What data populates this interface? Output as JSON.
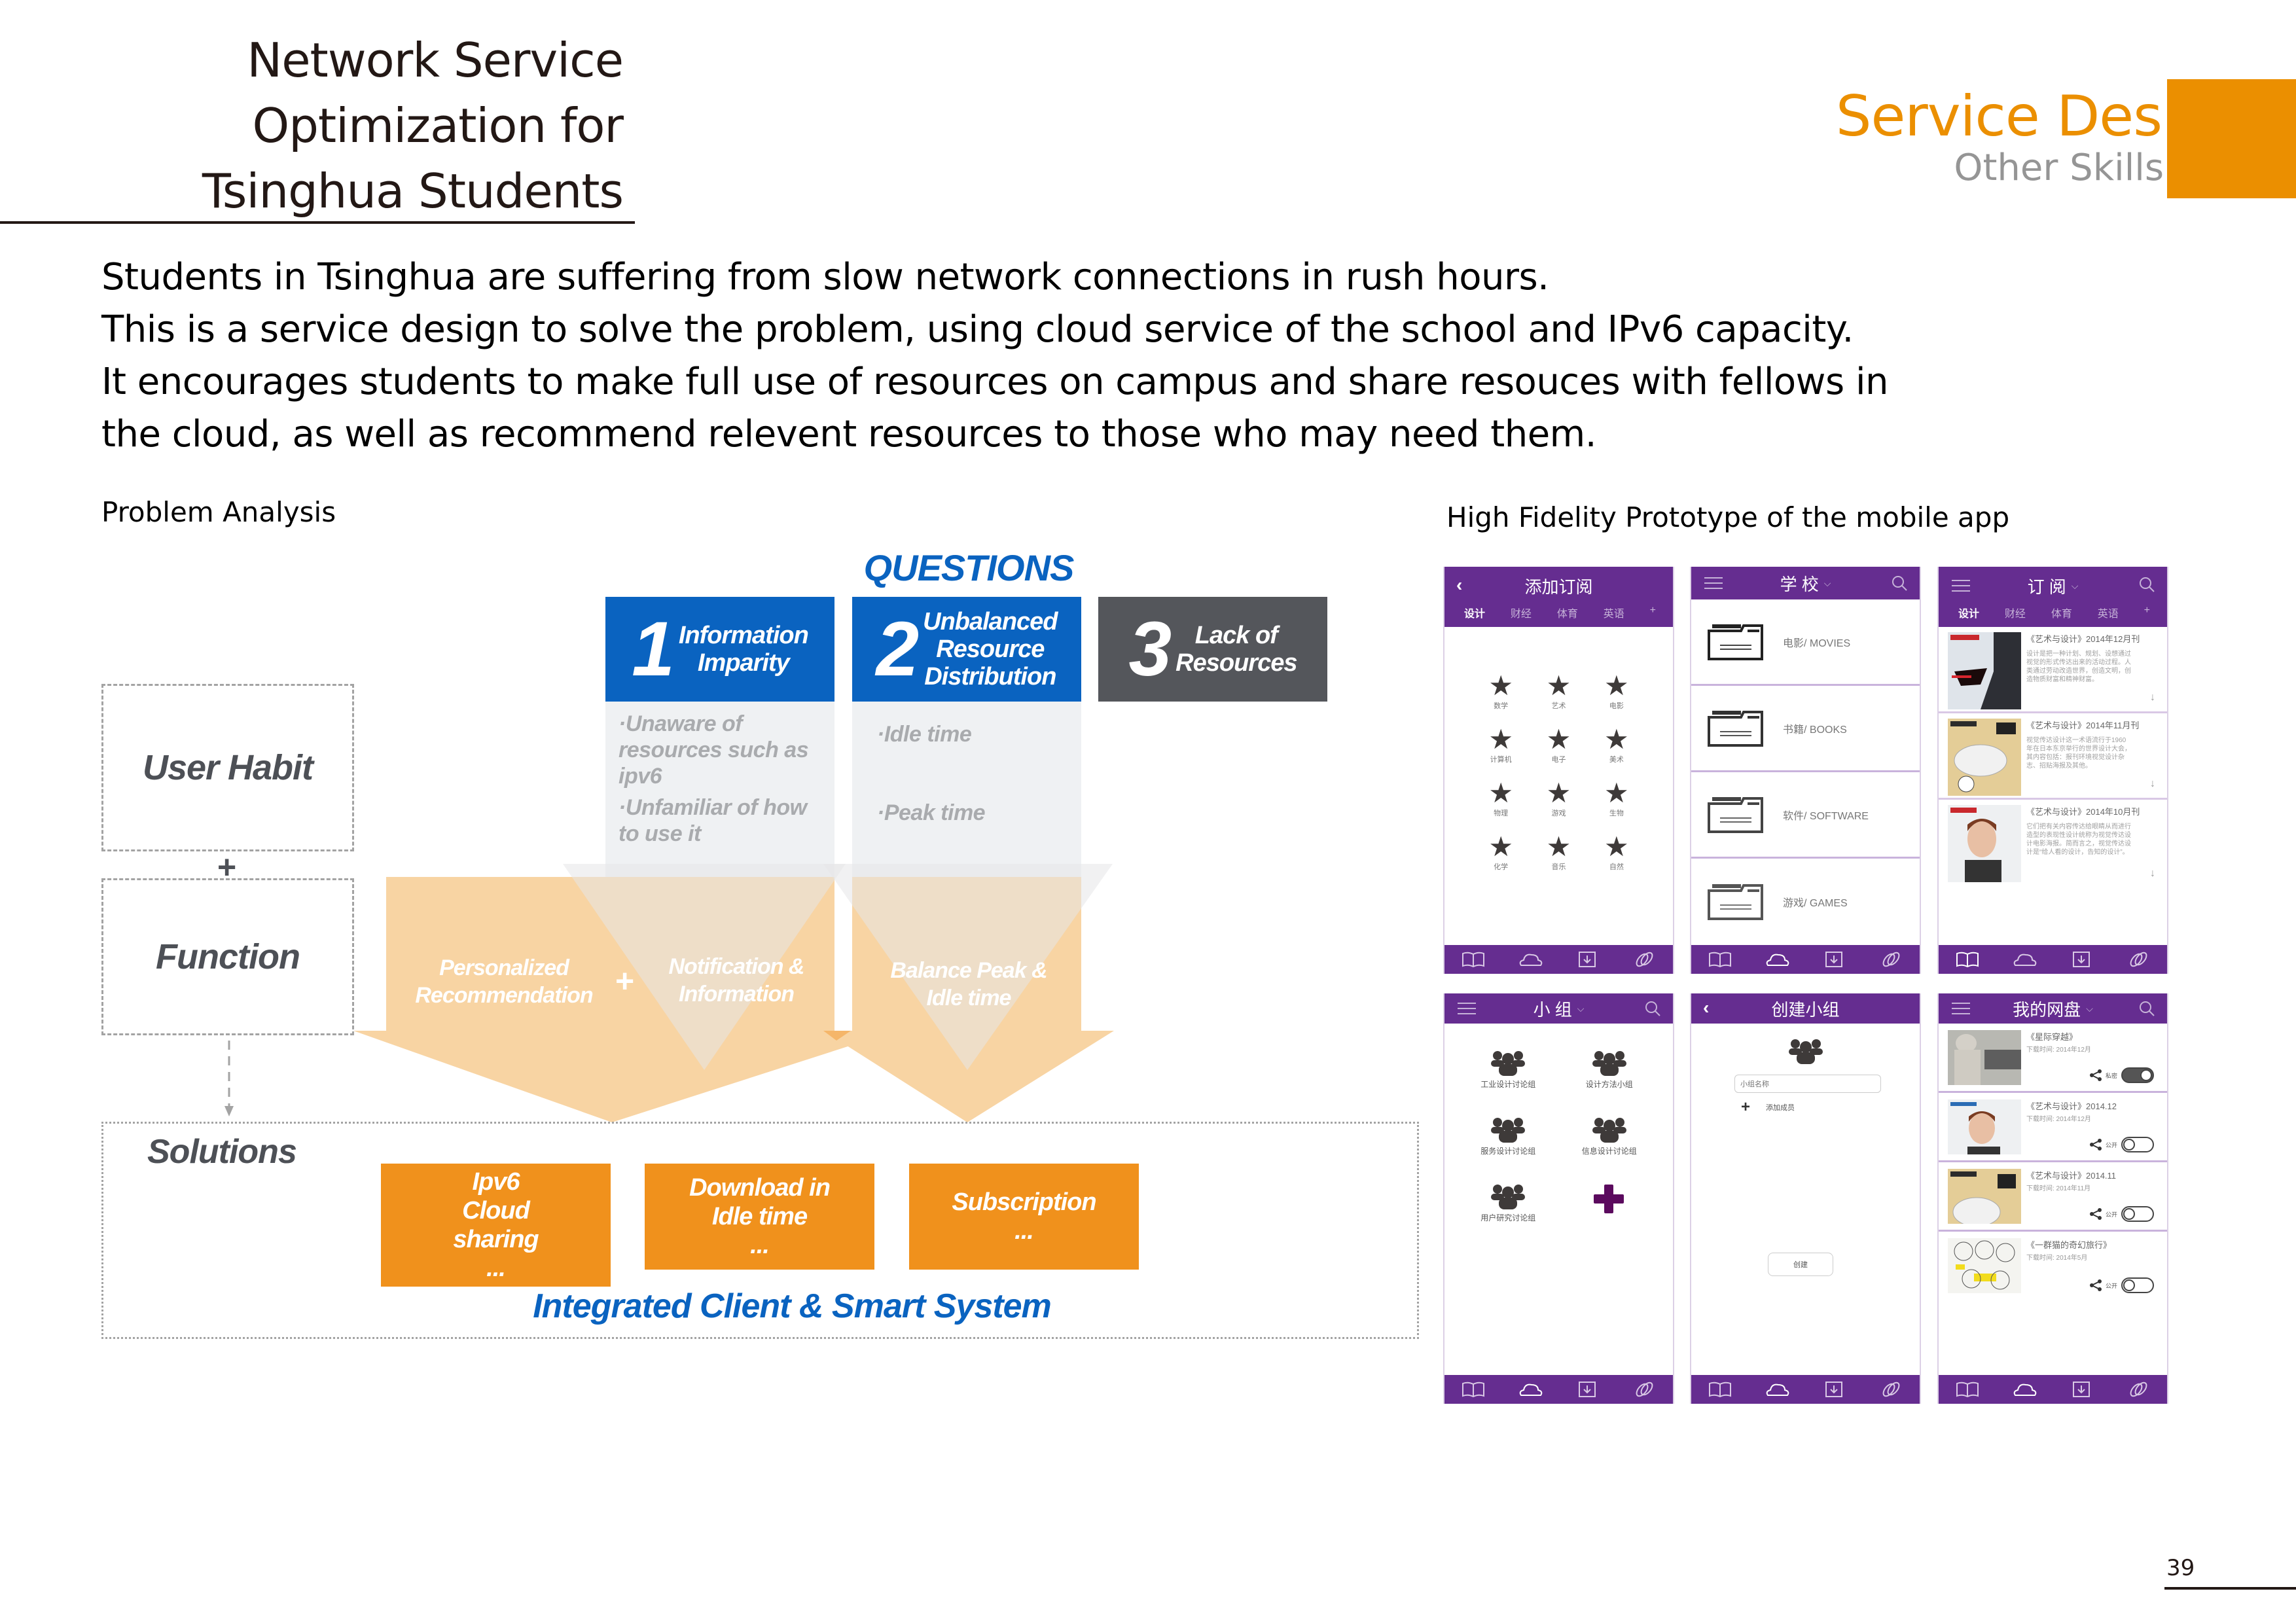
{
  "header": {
    "title_lines": [
      "Network Service",
      "Optimization for",
      "Tsinghua Students"
    ],
    "section_title": "Service Design",
    "section_subtitle": "Other Skills"
  },
  "intro": {
    "lines": [
      "Students in Tsinghua are suffering from slow network connections in rush hours.",
      "This is a service design to solve the problem, using cloud service of the school and IPv6 capacity.",
      "It encourages students to make full use of resources on campus and share resouces with fellows in",
      "the cloud, as well as recommend relevent resources to those who may need them."
    ]
  },
  "labels": {
    "problem_analysis": "Problem Analysis",
    "prototype": "High Fidelity Prototype of the mobile app"
  },
  "diagram": {
    "questions_heading": "QUESTIONS",
    "questions": [
      {
        "number": "1",
        "title_lines": [
          "Information",
          "Imparity"
        ],
        "color": "#0a63c0",
        "details": [
          "·Unaware of resources such as ipv6",
          "·Unfamiliar of  how to use it"
        ]
      },
      {
        "number": "2",
        "title_lines": [
          "Unbalanced",
          "Resource",
          "Distribution"
        ],
        "color": "#0a63c0",
        "details": [
          "·Idle time",
          "·Peak time"
        ]
      },
      {
        "number": "3",
        "title_lines": [
          "Lack of",
          "Resources"
        ],
        "color": "#54565b",
        "details": []
      }
    ],
    "user_habit": "User Habit",
    "plus": "+",
    "function": "Function",
    "functions": {
      "personalized_lines": [
        "Personalized",
        "Recommendation"
      ],
      "notification_lines": [
        "Notification &",
        "Information"
      ],
      "balance_lines": [
        "Balance Peak &",
        "Idle time"
      ]
    },
    "solutions_label": "Solutions",
    "solutions": [
      {
        "lines": [
          "Ipv6",
          "Cloud",
          "sharing",
          "..."
        ]
      },
      {
        "lines": [
          "Download in",
          "Idle time",
          "..."
        ]
      },
      {
        "lines": [
          "Subscription",
          "..."
        ]
      }
    ],
    "integrated_label": "Integrated Client & Smart System",
    "colors": {
      "blue": "#0a63c0",
      "gray_box": "#54565b",
      "light_orange": "#f8d4a3",
      "orange": "#f0911c"
    }
  },
  "app": {
    "accent_color": "#652d90",
    "tabs": [
      "设计",
      "财经",
      "体育",
      "英语",
      "+"
    ],
    "footer_icons": [
      "book-icon",
      "cloud-icon",
      "download-icon",
      "link-icon"
    ],
    "screens": {
      "add_subscription": {
        "title": "添加订阅",
        "topics": [
          "数学",
          "艺术",
          "电影",
          "计算机",
          "电子",
          "美术",
          "物理",
          "游戏",
          "生物",
          "化学",
          "音乐",
          "自然"
        ]
      },
      "school": {
        "title": "学 校",
        "folders": [
          "电影/ MOVIES",
          "书籍/ BOOKS",
          "软件/ SOFTWARE",
          "游戏/ GAMES"
        ]
      },
      "subscription": {
        "title": "订 阅",
        "items": [
          {
            "title": "《艺术与设计》2014年12月刊",
            "desc": "设计是把一种计划、规划、设想通过视觉的形式传达出来的活动过程。人类通过劳动改造世界，创造文明，创造物质财富和精神财富。"
          },
          {
            "title": "《艺术与设计》2014年11月刊",
            "desc": "视觉传达设计这一术语流行于1960年在日本东京举行的世界设计大会，其内容包括：报刊环境视觉设计杂志、招贴海报及其他。"
          },
          {
            "title": "《艺术与设计》2014年10月刊",
            "desc": "它们把有关内容传达给眼睛从而进行造型的表现性设计统称为视觉传达设计电影海报。简而言之，视觉传达设计是“给人看的设计，告知的设计”。"
          }
        ]
      },
      "groups": {
        "title": "小 组",
        "groups": [
          "工业设计讨论组",
          "设计方法小组",
          "服务设计讨论组",
          "信息设计讨论组",
          "用户研究讨论组"
        ]
      },
      "create_group": {
        "title": "创建小组",
        "name_placeholder": "小组名称",
        "add_member": "添加成员",
        "create_button": "创建"
      },
      "my_disk": {
        "title": "我的网盘",
        "items": [
          {
            "title": "《星际穿越》",
            "time": "下载时间:   2014年12月",
            "visibility": "私密",
            "toggle_on": true
          },
          {
            "title": "《艺术与设计》2014.12",
            "time": "下载时间:   2014年12月",
            "visibility": "公开",
            "toggle_on": false
          },
          {
            "title": "《艺术与设计》2014.11",
            "time": "下载时间:   2014年11月",
            "visibility": "公开",
            "toggle_on": false
          },
          {
            "title": "《一群猫的奇幻旅行》",
            "time": "下载时间:   2014年5月",
            "visibility": "公开",
            "toggle_on": false
          }
        ]
      }
    }
  },
  "page_number": "39"
}
